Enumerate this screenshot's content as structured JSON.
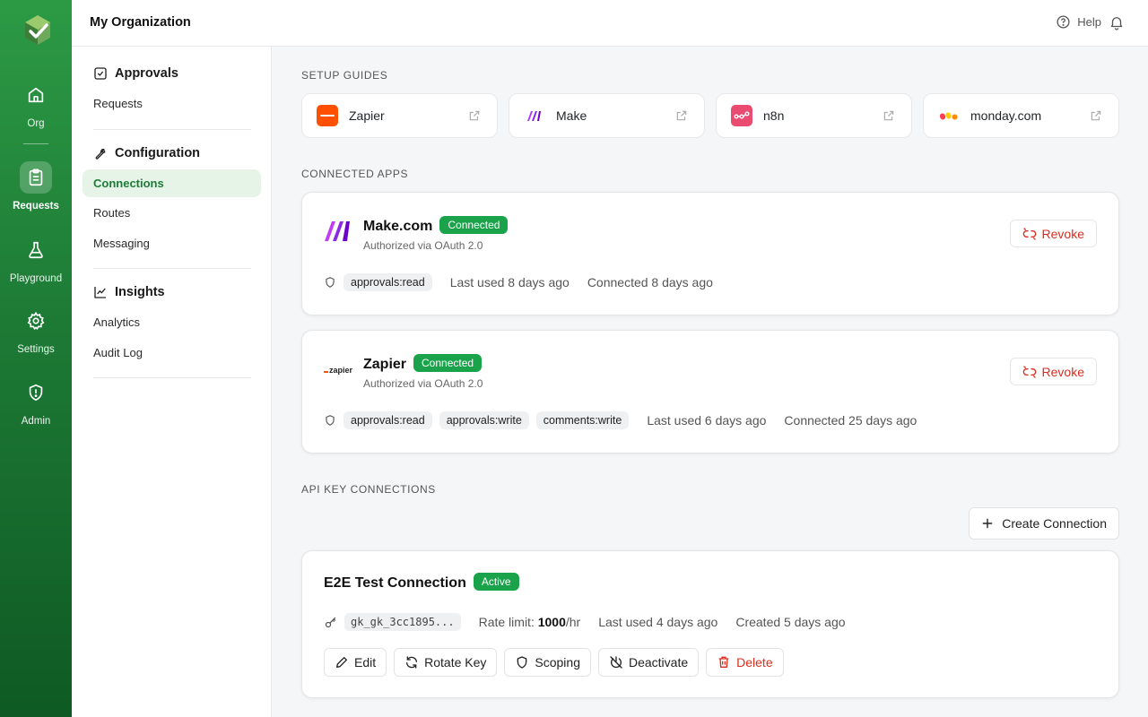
{
  "rail": {
    "items": [
      {
        "label": "Org",
        "icon": "home-icon"
      },
      {
        "label": "Requests",
        "icon": "clipboard-icon"
      },
      {
        "label": "Playground",
        "icon": "flask-icon"
      },
      {
        "label": "Settings",
        "icon": "gear-icon"
      },
      {
        "label": "Admin",
        "icon": "shield-alert-icon"
      }
    ],
    "active": "Requests"
  },
  "topbar": {
    "org_name": "My Organization",
    "help_label": "Help"
  },
  "sidebar": {
    "approvals_title": "Approvals",
    "requests": "Requests",
    "configuration_title": "Configuration",
    "connections": "Connections",
    "routes": "Routes",
    "messaging": "Messaging",
    "insights_title": "Insights",
    "analytics": "Analytics",
    "audit_log": "Audit Log"
  },
  "setup_guides": {
    "heading": "SETUP GUIDES",
    "items": [
      {
        "name": "Zapier",
        "color": "#ff4f00"
      },
      {
        "name": "Make",
        "color": "#6d00cc"
      },
      {
        "name": "n8n",
        "color": "#ea4b71"
      },
      {
        "name": "monday.com",
        "color": "#ff3d57"
      }
    ]
  },
  "connected_apps": {
    "heading": "CONNECTED APPS",
    "apps": [
      {
        "name": "Make.com",
        "status": "Connected",
        "auth": "Authorized via OAuth 2.0",
        "scopes": [
          "approvals:read"
        ],
        "last_used": "Last used 8 days ago",
        "connected": "Connected 8 days ago",
        "revoke": "Revoke"
      },
      {
        "name": "Zapier",
        "status": "Connected",
        "auth": "Authorized via OAuth 2.0",
        "scopes": [
          "approvals:read",
          "approvals:write",
          "comments:write"
        ],
        "last_used": "Last used 6 days ago",
        "connected": "Connected 25 days ago",
        "revoke": "Revoke"
      }
    ]
  },
  "api_keys": {
    "heading": "API KEY CONNECTIONS",
    "create_button": "Create Connection",
    "connection": {
      "name": "E2E Test Connection",
      "status": "Active",
      "key": "gk_gk_3cc1895...",
      "rate_label": "Rate limit:",
      "rate_value": "1000",
      "rate_unit": "/hr",
      "last_used": "Last used 4 days ago",
      "created": "Created 5 days ago",
      "actions": {
        "edit": "Edit",
        "rotate": "Rotate Key",
        "scoping": "Scoping",
        "deactivate": "Deactivate",
        "delete": "Delete"
      }
    }
  }
}
